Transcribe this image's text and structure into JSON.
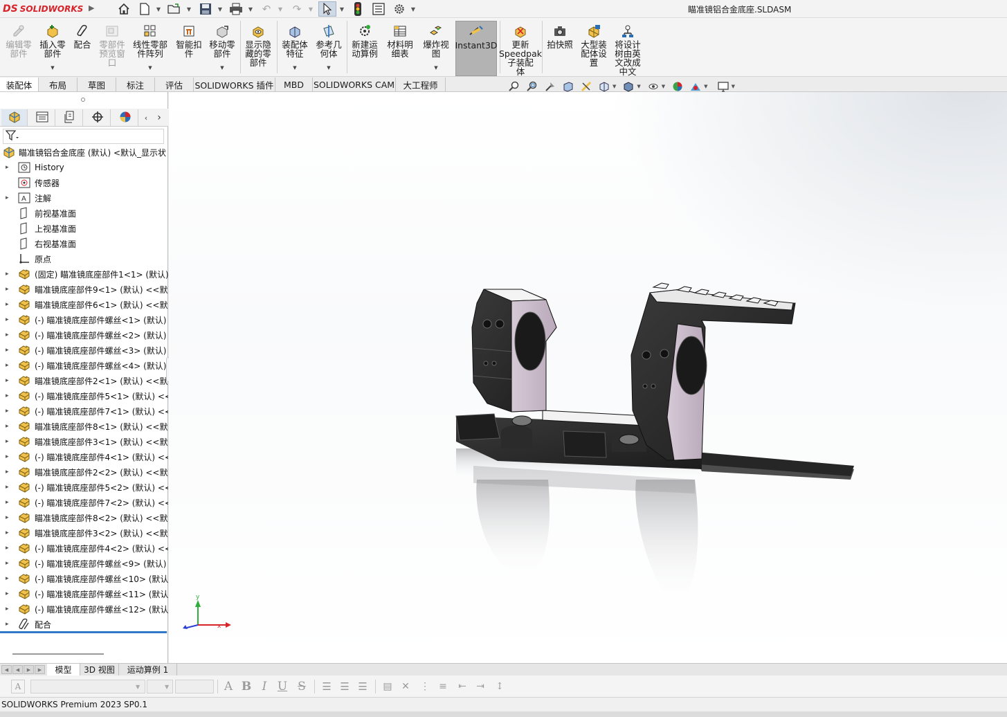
{
  "app": {
    "brand": "SOLIDWORKS",
    "brand_prefix": "DS",
    "document_title": "瞄准镜铝合金底座.SLDASM",
    "status_text": "SOLIDWORKS Premium 2023 SP0.1"
  },
  "quick_access": [
    {
      "icon": "home-icon"
    },
    {
      "icon": "new-document-icon"
    },
    {
      "icon": "open-folder-icon"
    },
    {
      "icon": "save-icon"
    },
    {
      "icon": "print-icon"
    },
    {
      "icon": "undo-icon"
    },
    {
      "icon": "redo-icon"
    },
    {
      "icon": "select-cursor-icon"
    },
    {
      "icon": "rebuild-traffic-light-icon"
    },
    {
      "icon": "file-properties-icon"
    },
    {
      "icon": "options-gear-icon"
    }
  ],
  "ribbon": {
    "buttons": [
      {
        "label": "编辑零\n部件",
        "icon": "edit-component-icon",
        "disabled": true
      },
      {
        "label": "插入零\n部件",
        "icon": "insert-component-icon",
        "disabled": false
      },
      {
        "label": "配合",
        "icon": "mate-paperclip-icon",
        "disabled": false
      },
      {
        "label": "零部件\n预览窗\n口",
        "icon": "component-preview-icon",
        "disabled": true
      },
      {
        "label": "线性零部\n件阵列",
        "icon": "linear-pattern-icon",
        "disabled": false
      },
      {
        "label": "智能扣\n件",
        "icon": "smart-fasteners-icon",
        "disabled": false
      },
      {
        "label": "移动零\n部件",
        "icon": "move-component-icon",
        "disabled": false
      },
      {
        "label": "显示隐\n藏的零\n部件",
        "icon": "show-hidden-icon",
        "disabled": false
      },
      {
        "label": "装配体\n特征",
        "icon": "assembly-features-icon",
        "disabled": false
      },
      {
        "label": "参考几\n何体",
        "icon": "reference-geometry-icon",
        "disabled": false
      },
      {
        "label": "新建运\n动算例",
        "icon": "new-motion-study-icon",
        "disabled": false
      },
      {
        "label": "材料明\n细表",
        "icon": "bill-of-materials-icon",
        "disabled": false
      },
      {
        "label": "爆炸视\n图",
        "icon": "exploded-view-icon",
        "disabled": false
      },
      {
        "label": "Instant3D",
        "icon": "instant3d-icon",
        "disabled": false,
        "active": true
      },
      {
        "label": "更新\nSpeedpak\n子装配\n体",
        "icon": "speedpak-icon",
        "disabled": false
      },
      {
        "label": "拍快照",
        "icon": "snapshot-camera-icon",
        "disabled": false
      },
      {
        "label": "大型装\n配体设\n置",
        "icon": "large-assembly-icon",
        "disabled": false
      },
      {
        "label": "将设计\n树由英\n文改成\n中文",
        "icon": "translate-tree-icon",
        "disabled": false
      }
    ]
  },
  "tabs": [
    "装配体",
    "布局",
    "草图",
    "标注",
    "评估",
    "SOLIDWORKS 插件",
    "MBD",
    "SOLIDWORKS CAM",
    "大工程师"
  ],
  "active_tab": "装配体",
  "panel": {
    "tabs": [
      "feature-manager-icon",
      "property-manager-icon",
      "configuration-manager-icon",
      "dimxpert-icon",
      "display-manager-icon"
    ],
    "filter_icon": "filter-funnel-icon",
    "root_label": "瞄准镜铝合金底座 (默认) <默认_显示状",
    "items": [
      {
        "label": "History",
        "icon": "history-icon",
        "expand": true
      },
      {
        "label": "传感器",
        "icon": "sensor-icon",
        "expand": false
      },
      {
        "label": "注解",
        "icon": "annotations-icon",
        "expand": true
      },
      {
        "label": "前视基准面",
        "icon": "plane-icon",
        "expand": false
      },
      {
        "label": "上视基准面",
        "icon": "plane-icon",
        "expand": false
      },
      {
        "label": "右视基准面",
        "icon": "plane-icon",
        "expand": false
      },
      {
        "label": "原点",
        "icon": "origin-icon",
        "expand": false
      },
      {
        "label": "(固定) 瞄准镜底座部件1<1> (默认)",
        "icon": "part-icon",
        "expand": true
      },
      {
        "label": "瞄准镜底座部件9<1> (默认) <<默认",
        "icon": "part-icon",
        "expand": true
      },
      {
        "label": "瞄准镜底座部件6<1> (默认) <<默认",
        "icon": "part-icon",
        "expand": true
      },
      {
        "label": "(-) 瞄准镜底座部件螺丝<1> (默认)",
        "icon": "part-icon",
        "expand": true
      },
      {
        "label": "(-) 瞄准镜底座部件螺丝<2> (默认)",
        "icon": "part-icon",
        "expand": true
      },
      {
        "label": "(-) 瞄准镜底座部件螺丝<3> (默认)",
        "icon": "part-icon",
        "expand": true
      },
      {
        "label": "(-) 瞄准镜底座部件螺丝<4> (默认)",
        "icon": "part-icon",
        "expand": true
      },
      {
        "label": "瞄准镜底座部件2<1> (默认) <<默认",
        "icon": "part-icon",
        "expand": true
      },
      {
        "label": "(-) 瞄准镜底座部件5<1> (默认) <<",
        "icon": "part-icon",
        "expand": true
      },
      {
        "label": "(-) 瞄准镜底座部件7<1> (默认) <<",
        "icon": "part-icon",
        "expand": true
      },
      {
        "label": "瞄准镜底座部件8<1> (默认) <<默认",
        "icon": "part-icon",
        "expand": true
      },
      {
        "label": "瞄准镜底座部件3<1> (默认) <<默认",
        "icon": "part-icon",
        "expand": true
      },
      {
        "label": "(-) 瞄准镜底座部件4<1> (默认) <<",
        "icon": "part-icon",
        "expand": true
      },
      {
        "label": "瞄准镜底座部件2<2> (默认) <<默认",
        "icon": "part-icon",
        "expand": true
      },
      {
        "label": "(-) 瞄准镜底座部件5<2> (默认) <<",
        "icon": "part-icon",
        "expand": true
      },
      {
        "label": "(-) 瞄准镜底座部件7<2> (默认) <<",
        "icon": "part-icon",
        "expand": true
      },
      {
        "label": "瞄准镜底座部件8<2> (默认) <<默认",
        "icon": "part-icon",
        "expand": true
      },
      {
        "label": "瞄准镜底座部件3<2> (默认) <<默认",
        "icon": "part-icon",
        "expand": true
      },
      {
        "label": "(-) 瞄准镜底座部件4<2> (默认) <<",
        "icon": "part-icon",
        "expand": true
      },
      {
        "label": "(-) 瞄准镜底座部件螺丝<9> (默认)",
        "icon": "part-icon",
        "expand": true
      },
      {
        "label": "(-) 瞄准镜底座部件螺丝<10> (默认",
        "icon": "part-icon",
        "expand": true
      },
      {
        "label": "(-) 瞄准镜底座部件螺丝<11> (默认",
        "icon": "part-icon",
        "expand": true
      },
      {
        "label": "(-) 瞄准镜底座部件螺丝<12> (默认",
        "icon": "part-icon",
        "expand": true
      },
      {
        "label": "配合",
        "icon": "mates-icon",
        "expand": true
      }
    ]
  },
  "triad": {
    "x_label": "x",
    "y_label": "y"
  },
  "bottom_tabs": [
    "模型",
    "3D 视图",
    "运动算例 1"
  ],
  "active_bottom_tab": "模型",
  "format_toolbar": {
    "font_placeholder": "",
    "size_placeholder": ""
  },
  "colors": {
    "accent": "#2f79c6",
    "brand": "#d8232a",
    "part_gold": "#e8b53a",
    "ring_lavender": "#c7b9c8"
  }
}
